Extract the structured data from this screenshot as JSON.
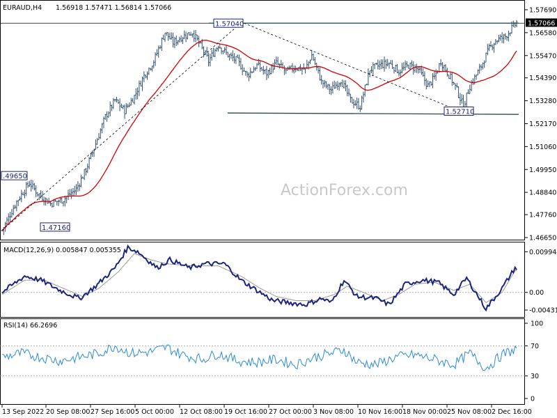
{
  "chart_data": {
    "type": "candlestick",
    "symbol": "EURAUD,H4",
    "ohlc_header": "1.56918 1.57471 1.56814 1.57066",
    "watermark": "ActionForex.com",
    "price_axis": {
      "ticks": [
        "1.57690",
        "1.56580",
        "1.55470",
        "1.54390",
        "1.53280",
        "1.52170",
        "1.51060",
        "1.49950",
        "1.48840",
        "1.47760",
        "1.46650"
      ],
      "tick_values": [
        1.5769,
        1.5658,
        1.5547,
        1.5439,
        1.5328,
        1.5217,
        1.5106,
        1.4995,
        1.4884,
        1.4776,
        1.4665
      ],
      "ylim": [
        1.4665,
        1.5769
      ],
      "current_price_label": "1.57066",
      "current_price": 1.57066
    },
    "time_axis": [
      "13 Sep 2022",
      "20 Sep 08:00",
      "27 Sep 16:00",
      "5 Oct 00:00",
      "12 Oct 08:00",
      "19 Oct 16:00",
      "27 Oct 00:00",
      "3 Nov 08:00",
      "10 Nov 16:00",
      "18 Nov 00:00",
      "25 Nov 08:00",
      "2 Dec 16:00"
    ],
    "annotations": [
      {
        "text": "1.57040",
        "value": 1.5704
      },
      {
        "text": "1.52710",
        "value": 1.5271
      },
      {
        "text": ".49650",
        "value": 1.4965
      },
      {
        "text": "1.47160",
        "value": 1.4716
      }
    ],
    "horizontal_levels": [
      1.5704,
      1.5262
    ],
    "price_anchors": [
      [
        0,
        1.47
      ],
      [
        9,
        1.484
      ],
      [
        17,
        1.493
      ],
      [
        22,
        1.488
      ],
      [
        30,
        1.483
      ],
      [
        38,
        1.485
      ],
      [
        46,
        1.49
      ],
      [
        52,
        1.4995
      ],
      [
        58,
        1.512
      ],
      [
        64,
        1.525
      ],
      [
        70,
        1.533
      ],
      [
        76,
        1.528
      ],
      [
        82,
        1.535
      ],
      [
        88,
        1.545
      ],
      [
        94,
        1.552
      ],
      [
        98,
        1.56
      ],
      [
        101,
        1.566
      ],
      [
        106,
        1.561
      ],
      [
        112,
        1.564
      ],
      [
        118,
        1.566
      ],
      [
        124,
        1.558
      ],
      [
        128,
        1.552
      ],
      [
        134,
        1.56
      ],
      [
        140,
        1.555
      ],
      [
        146,
        1.552
      ],
      [
        152,
        1.545
      ],
      [
        158,
        1.55
      ],
      [
        164,
        1.546
      ],
      [
        170,
        1.551
      ],
      [
        176,
        1.547
      ],
      [
        182,
        1.549
      ],
      [
        188,
        1.548
      ],
      [
        192,
        1.555
      ],
      [
        198,
        1.542
      ],
      [
        204,
        1.538
      ],
      [
        210,
        1.543
      ],
      [
        216,
        1.533
      ],
      [
        222,
        1.53
      ],
      [
        228,
        1.548
      ],
      [
        234,
        1.55
      ],
      [
        240,
        1.551
      ],
      [
        246,
        1.547
      ],
      [
        252,
        1.55
      ],
      [
        258,
        1.548
      ],
      [
        264,
        1.54
      ],
      [
        268,
        1.544
      ],
      [
        272,
        1.552
      ],
      [
        278,
        1.544
      ],
      [
        282,
        1.538
      ],
      [
        286,
        1.53
      ],
      [
        290,
        1.54
      ],
      [
        296,
        1.548
      ],
      [
        302,
        1.558
      ],
      [
        306,
        1.562
      ],
      [
        312,
        1.564
      ],
      [
        319,
        1.5707
      ]
    ],
    "macd": {
      "label": "MACD(12,26,9) 0.005847 0.005355",
      "ticks": [
        "0.009944",
        "0.00",
        "-0.004313"
      ],
      "tick_values": [
        0.009944,
        0.0,
        -0.004313
      ],
      "ylim": [
        -0.0055,
        0.0112
      ],
      "main_anchors": [
        [
          0,
          0.0
        ],
        [
          14,
          0.004
        ],
        [
          24,
          0.003
        ],
        [
          36,
          0.0005
        ],
        [
          48,
          -0.0015
        ],
        [
          58,
          0.0015
        ],
        [
          70,
          0.006
        ],
        [
          78,
          0.011
        ],
        [
          84,
          0.01
        ],
        [
          96,
          0.006
        ],
        [
          104,
          0.008
        ],
        [
          116,
          0.006
        ],
        [
          126,
          0.007
        ],
        [
          138,
          0.007
        ],
        [
          148,
          0.003
        ],
        [
          158,
          0.0005
        ],
        [
          168,
          -0.002
        ],
        [
          178,
          -0.0025
        ],
        [
          188,
          -0.003
        ],
        [
          198,
          -0.0015
        ],
        [
          204,
          -0.0025
        ],
        [
          212,
          0.003
        ],
        [
          220,
          -0.001
        ],
        [
          232,
          -0.0015
        ],
        [
          240,
          -0.003
        ],
        [
          250,
          0.002
        ],
        [
          260,
          0.003
        ],
        [
          270,
          0.0025
        ],
        [
          280,
          -0.0005
        ],
        [
          288,
          0.0035
        ],
        [
          300,
          -0.004
        ],
        [
          310,
          0.001
        ],
        [
          318,
          0.006
        ],
        [
          319,
          0.0058
        ]
      ],
      "signal_anchors": [
        [
          0,
          -0.0005
        ],
        [
          14,
          0.003
        ],
        [
          26,
          0.003
        ],
        [
          38,
          0.001
        ],
        [
          50,
          -0.001
        ],
        [
          60,
          0.001
        ],
        [
          72,
          0.005
        ],
        [
          82,
          0.0095
        ],
        [
          92,
          0.008
        ],
        [
          102,
          0.007
        ],
        [
          118,
          0.0065
        ],
        [
          134,
          0.0065
        ],
        [
          148,
          0.004
        ],
        [
          160,
          0.001
        ],
        [
          170,
          -0.001
        ],
        [
          182,
          -0.002
        ],
        [
          194,
          -0.002
        ],
        [
          206,
          -0.0005
        ],
        [
          214,
          0.0015
        ],
        [
          224,
          0.0
        ],
        [
          236,
          -0.002
        ],
        [
          246,
          -0.0005
        ],
        [
          256,
          0.002
        ],
        [
          268,
          0.0025
        ],
        [
          280,
          0.0005
        ],
        [
          290,
          0.002
        ],
        [
          300,
          -0.0025
        ],
        [
          310,
          0.0
        ],
        [
          318,
          0.0053
        ],
        [
          319,
          0.0054
        ]
      ]
    },
    "rsi": {
      "label": "RSI(14) 66.2696",
      "ticks": [
        "100",
        "70",
        "30",
        "0"
      ],
      "tick_values": [
        100,
        70,
        30,
        0
      ],
      "ylim": [
        0,
        100
      ],
      "levels": [
        70,
        30
      ],
      "anchors": [
        [
          0,
          55
        ],
        [
          12,
          60
        ],
        [
          24,
          55
        ],
        [
          36,
          50
        ],
        [
          48,
          55
        ],
        [
          60,
          60
        ],
        [
          70,
          70
        ],
        [
          80,
          60
        ],
        [
          92,
          62
        ],
        [
          102,
          68
        ],
        [
          112,
          58
        ],
        [
          124,
          52
        ],
        [
          134,
          60
        ],
        [
          146,
          50
        ],
        [
          158,
          48
        ],
        [
          170,
          52
        ],
        [
          182,
          45
        ],
        [
          194,
          55
        ],
        [
          204,
          60
        ],
        [
          212,
          65
        ],
        [
          220,
          48
        ],
        [
          232,
          45
        ],
        [
          244,
          55
        ],
        [
          256,
          58
        ],
        [
          268,
          52
        ],
        [
          280,
          45
        ],
        [
          290,
          60
        ],
        [
          300,
          40
        ],
        [
          310,
          58
        ],
        [
          319,
          66
        ]
      ]
    },
    "colors": {
      "bar": "#2f4f6f",
      "ma": "#d40000",
      "macd": "#1a237e",
      "macd_signal": "#999999",
      "rsi": "#2a8bd6",
      "grid": "#999999",
      "level": "#1f4e4e"
    }
  }
}
